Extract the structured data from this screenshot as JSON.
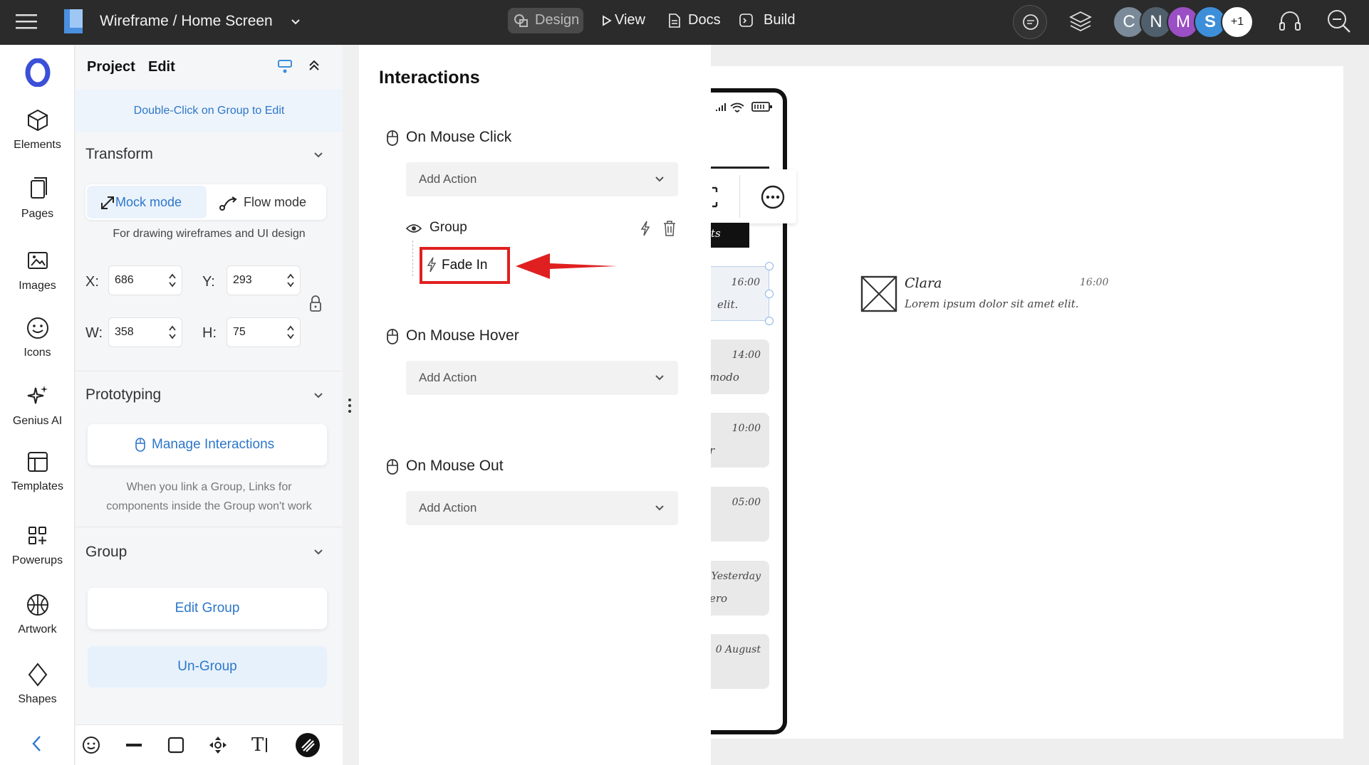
{
  "topbar": {
    "title": "Wireframe / Home Screen",
    "nav": {
      "design": "Design",
      "view": "View",
      "docs": "Docs",
      "build": "Build"
    },
    "avatars": [
      {
        "letter": "C",
        "color": "#7a8a99"
      },
      {
        "letter": "N",
        "color": "#4f5f6b"
      },
      {
        "letter": "M",
        "color": "#9b4fc4"
      },
      {
        "letter": "S",
        "color": "#3d8fd9"
      }
    ],
    "avatar_more": "+1"
  },
  "rail": {
    "items": [
      {
        "label": "Elements",
        "icon": "cube-icon"
      },
      {
        "label": "Pages",
        "icon": "pages-icon"
      },
      {
        "label": "Images",
        "icon": "images-icon"
      },
      {
        "label": "Icons",
        "icon": "smiley-icon"
      },
      {
        "label": "Genius AI",
        "icon": "sparkle-icon"
      },
      {
        "label": "Templates",
        "icon": "templates-icon"
      },
      {
        "label": "Powerups",
        "icon": "powerups-icon"
      },
      {
        "label": "Artwork",
        "icon": "artwork-icon"
      },
      {
        "label": "Shapes",
        "icon": "diamond-icon"
      }
    ]
  },
  "panel": {
    "tabs": {
      "project": "Project",
      "edit": "Edit"
    },
    "hint": "Double-Click on Group to Edit",
    "transform": {
      "title": "Transform",
      "mock_mode": "Mock mode",
      "flow_mode": "Flow mode",
      "mode_desc": "For drawing wireframes and UI design",
      "x_label": "X:",
      "x": "686",
      "y_label": "Y:",
      "y": "293",
      "w_label": "W:",
      "w": "358",
      "h_label": "H:",
      "h": "75"
    },
    "prototyping": {
      "title": "Prototyping",
      "manage": "Manage Interactions",
      "note_line1": "When you link a Group, Links for",
      "note_line2": "components inside the Group won't work"
    },
    "group": {
      "title": "Group",
      "edit_group": "Edit Group",
      "ungroup": "Un-Group"
    }
  },
  "interactions": {
    "title": "Interactions",
    "events": [
      {
        "label": "On Mouse Click",
        "action_placeholder": "Add Action"
      },
      {
        "label": "On Mouse Hover",
        "action_placeholder": "Add Action"
      },
      {
        "label": "On Mouse Out",
        "action_placeholder": "Add Action"
      }
    ],
    "group_label": "Group",
    "effect": "Fade In"
  },
  "canvas": {
    "message": {
      "name": "Clara",
      "time": "16:00",
      "text": "Lorem ipsum dolor sit amet elit."
    },
    "phone_rows": [
      {
        "time": "16:00",
        "snippet": "elit."
      },
      {
        "time": "14:00",
        "snippet": "modo"
      },
      {
        "time": "10:00",
        "snippet": "r"
      },
      {
        "time": "05:00",
        "snippet": ""
      },
      {
        "time": "Yesterday",
        "snippet": "ero"
      },
      {
        "time": "0 August",
        "snippet": ""
      }
    ],
    "phone_tab": "ts"
  },
  "colors": {
    "accent": "#2d77c9",
    "highlight": "#e02020",
    "topbar": "#2b2b2b"
  }
}
